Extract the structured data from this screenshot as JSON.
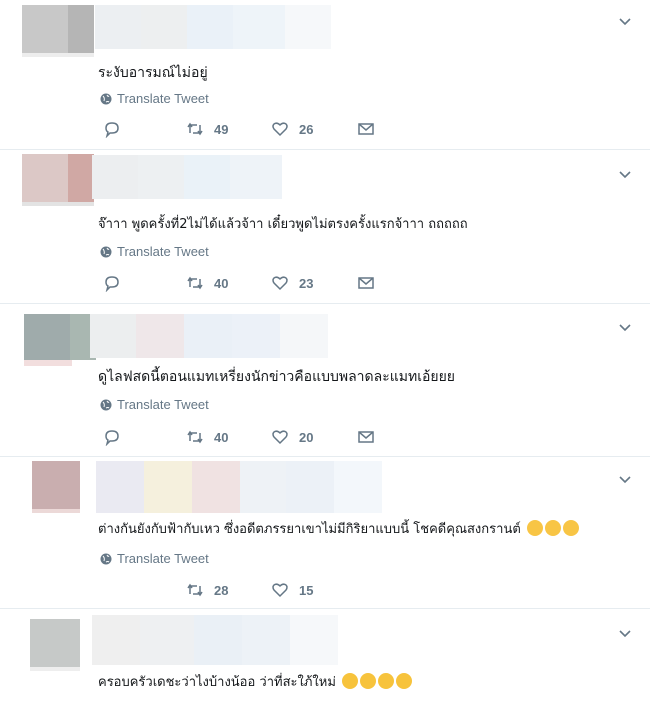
{
  "colors": {
    "muted": "#657786",
    "divider": "#e6ecf0",
    "text": "#14171a"
  },
  "translate_label": "Translate Tweet",
  "tweets": [
    {
      "text": "ระงับอารมณ์ไม่อยู่",
      "emojis": [],
      "retweets": "49",
      "likes": "26",
      "replies": ""
    },
    {
      "text": "จ๊าาา พูดครั้งที่2ไม่ได้แล้วจ้าา เดี๋ยวพูดไม่ตรงครั้งแรกจ้าาา  ถถถถถ",
      "emojis": [],
      "retweets": "40",
      "likes": "23",
      "replies": ""
    },
    {
      "text": "ดูไลฟสดนี้ตอนแมทเหรี่ยงนักข่าวคือแบบพลาดละแมทเอ้ยยย",
      "emojis": [],
      "retweets": "40",
      "likes": "20",
      "replies": ""
    },
    {
      "text": "ต่างกันยังกับฟ้ากับเหว ซึ่งอดีตภรรยาเขาไม่มีกิริยาแบบนี้ โชคดีคุณสงกรานต์",
      "emojis": [
        "unamused-face-icon",
        "unamused-face-icon",
        "unamused-face-icon"
      ],
      "retweets": "28",
      "likes": "15",
      "replies": ""
    },
    {
      "text": "ครอบครัวเดชะว่าไงบ้างน้ออ ว่าที่สะใภ้ใหม่",
      "emojis": [
        "rolling-laughing-icon",
        "rolling-laughing-icon",
        "rolling-laughing-icon",
        "rolling-laughing-icon"
      ]
    }
  ]
}
